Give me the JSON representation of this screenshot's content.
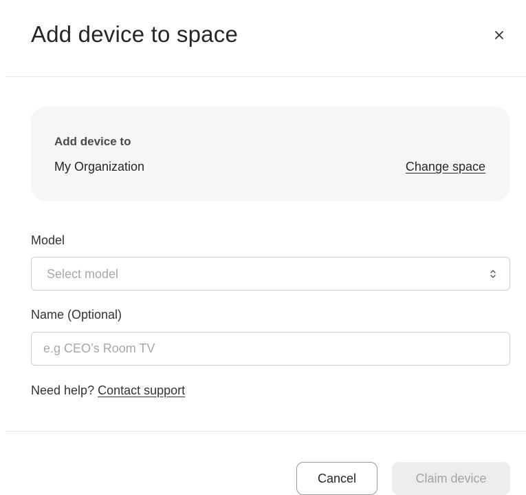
{
  "dialog": {
    "title": "Add device to space",
    "close_icon": "close-icon"
  },
  "space_card": {
    "label": "Add device to",
    "value": "My Organization",
    "change_link": "Change space"
  },
  "model_field": {
    "label": "Model",
    "placeholder": "Select model",
    "icon": "chevron-up-down-icon"
  },
  "name_field": {
    "label": "Name (Optional)",
    "placeholder": "e.g CEO’s Room TV",
    "value": ""
  },
  "help": {
    "prefix": "Need help?",
    "link": "Contact support"
  },
  "footer": {
    "cancel_label": "Cancel",
    "claim_label": "Claim device",
    "claim_disabled": true
  },
  "colors": {
    "card_background": "#f6f6f6",
    "disabled_button_background": "#ededed",
    "disabled_button_text": "#a3a3a3",
    "border": "#cfcfcf"
  }
}
